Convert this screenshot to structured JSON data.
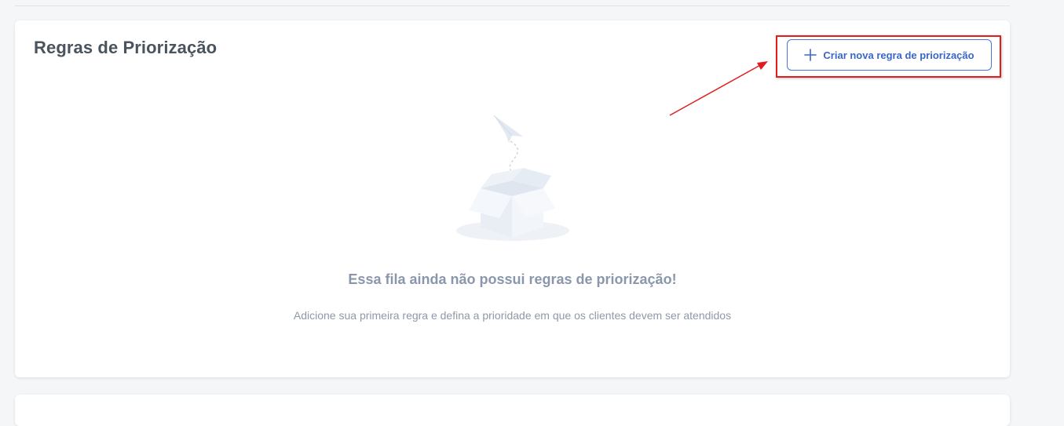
{
  "section": {
    "title": "Regras de Priorização",
    "create_button_label": "Criar nova regra de priorização",
    "create_button_icon": "plus-icon"
  },
  "empty_state": {
    "illustration": "empty-box-icon",
    "title": "Essa fila ainda não possui regras de priorização!",
    "subtitle": "Adicione sua primeira regra e defina a prioridade em que os clientes devem ser atendidos"
  },
  "annotation": {
    "color": "#e01e1e"
  },
  "colors": {
    "accent": "#3a66c8",
    "background": "#f4f6f8",
    "card": "#ffffff"
  }
}
